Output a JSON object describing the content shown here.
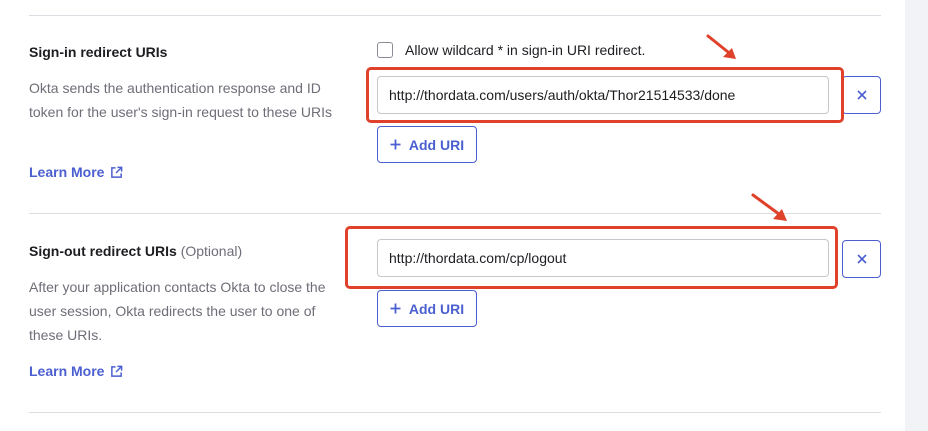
{
  "signin": {
    "title": "Sign-in redirect URIs",
    "wildcard_label": "Allow wildcard * in sign-in URI redirect.",
    "description": "Okta sends the authentication response and ID token for the user's sign-in request to these URIs",
    "learn_more": "Learn More",
    "uri_value": "http://thordata.com/users/auth/okta/Thor21514533/done",
    "add_uri_label": "Add URI"
  },
  "signout": {
    "title": "Sign-out redirect URIs",
    "optional": "(Optional)",
    "description": "After your application contacts Okta to close the user session, Okta redirects the user to one of these URIs.",
    "learn_more": "Learn More",
    "uri_value": "http://thordata.com/cp/logout",
    "add_uri_label": "Add URI"
  },
  "icons": {
    "external_link": "external-link-icon",
    "close": "close-icon",
    "plus": "plus-icon",
    "arrow": "red-arrow-annotation"
  },
  "colors": {
    "accent": "#4b5fd1",
    "annotation": "#e0412b",
    "muted_text": "#6e6e78",
    "divider": "#dcdce2"
  }
}
